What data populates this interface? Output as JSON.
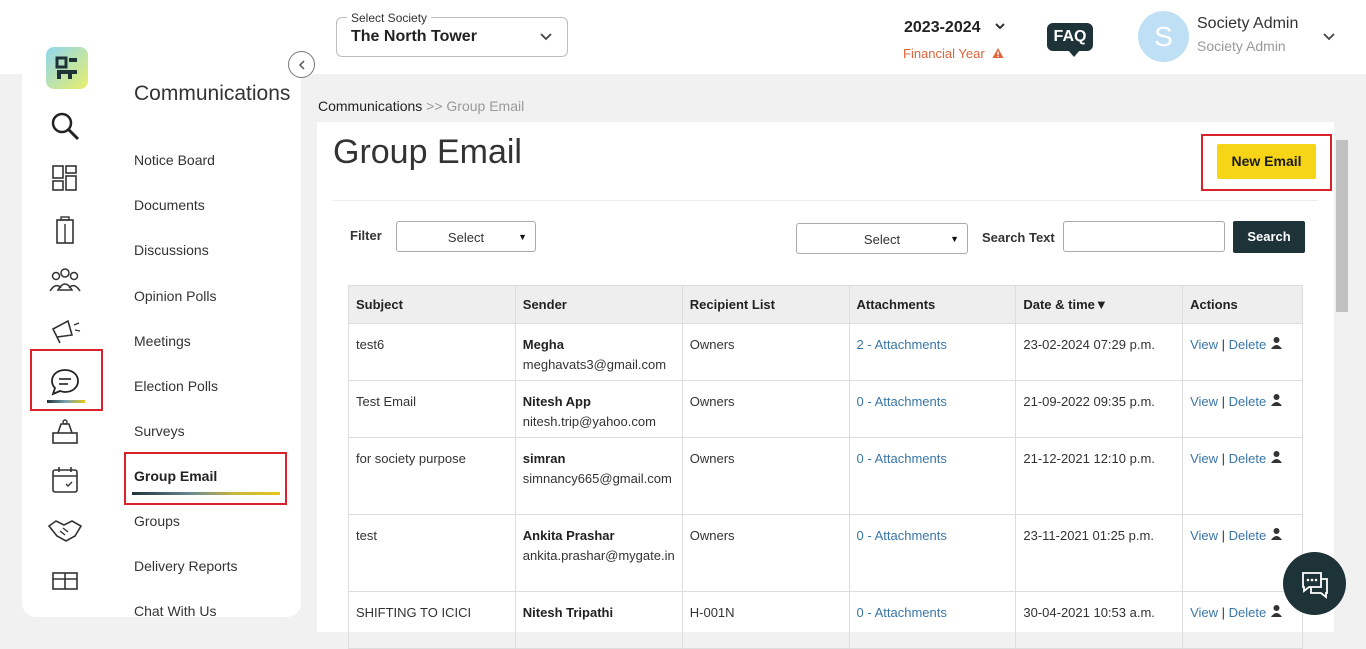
{
  "society": {
    "label": "Select Society",
    "value": "The North Tower"
  },
  "financial_year": {
    "value": "2023-2024",
    "label": "Financial Year"
  },
  "faq_label": "FAQ",
  "user": {
    "initial": "S",
    "name": "Society Admin",
    "role": "Society Admin"
  },
  "sidebar": {
    "title": "Communications",
    "items": [
      {
        "label": "Notice Board"
      },
      {
        "label": "Documents"
      },
      {
        "label": "Discussions"
      },
      {
        "label": "Opinion Polls"
      },
      {
        "label": "Meetings"
      },
      {
        "label": "Election Polls"
      },
      {
        "label": "Surveys"
      },
      {
        "label": "Group Email"
      },
      {
        "label": "Groups"
      },
      {
        "label": "Delivery Reports"
      },
      {
        "label": "Chat With Us"
      }
    ]
  },
  "breadcrumb": {
    "parent": "Communications",
    "sep": ">>",
    "current": "Group Email"
  },
  "page": {
    "title": "Group Email",
    "new_button": "New Email"
  },
  "filters": {
    "filter_label": "Filter",
    "select1": "Select",
    "select2": "Select",
    "search_label": "Search Text",
    "search_button": "Search"
  },
  "table": {
    "headers": [
      "Subject",
      "Sender",
      "Recipient List",
      "Attachments",
      "Date & time",
      "Actions"
    ],
    "sort_indicator": "▼",
    "view_label": "View",
    "delete_label": "Delete",
    "rows": [
      {
        "subject": "test6",
        "sender_name": "Megha",
        "sender_email": "meghavats3@gmail.com",
        "recipients": "Owners",
        "attachments": "2 - Attachments",
        "date": "23-02-2024 07:29 p.m."
      },
      {
        "subject": "Test Email",
        "sender_name": "Nitesh App",
        "sender_email": "nitesh.trip@yahoo.com",
        "recipients": "Owners",
        "attachments": "0 - Attachments",
        "date": "21-09-2022 09:35 p.m."
      },
      {
        "subject": "for society purpose",
        "sender_name": "simran",
        "sender_email": "simnancy665@gmail.com",
        "recipients": "Owners",
        "attachments": "0 - Attachments",
        "date": "21-12-2021 12:10 p.m."
      },
      {
        "subject": "test",
        "sender_name": "Ankita Prashar",
        "sender_email": "ankita.prashar@mygate.in",
        "recipients": "Owners",
        "attachments": "0 - Attachments",
        "date": "23-11-2021 01:25 p.m."
      },
      {
        "subject": "SHIFTING TO ICICI",
        "sender_name": "Nitesh Tripathi",
        "sender_email": "",
        "recipients": "H-001N",
        "attachments": "0 - Attachments",
        "date": "30-04-2021 10:53 a.m."
      }
    ]
  },
  "colors": {
    "brand_dark": "#1e3338",
    "accent_yellow": "#f6d416",
    "highlight_red": "#d9222a",
    "link_blue": "#3a76a8",
    "warning_orange": "#e0653a"
  }
}
